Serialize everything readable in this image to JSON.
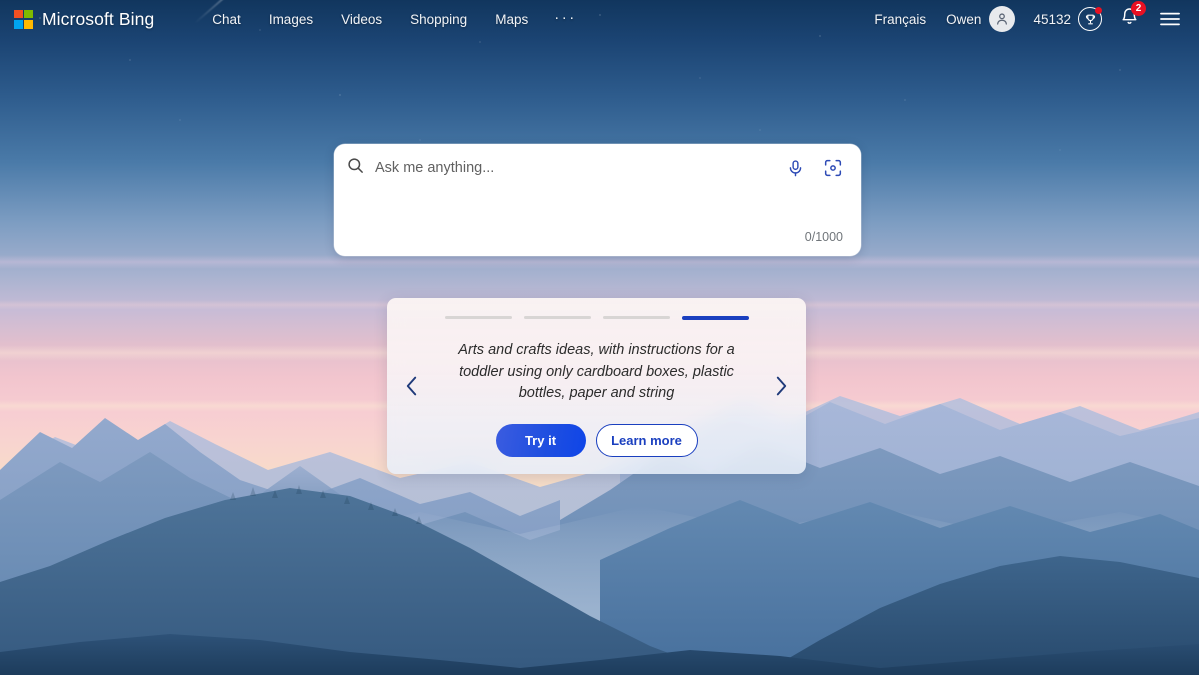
{
  "header": {
    "brand": "Microsoft Bing",
    "logo_colors": [
      "#f25022",
      "#7fba00",
      "#00a4ef",
      "#ffb900"
    ],
    "nav": [
      {
        "label": "Chat",
        "name": "nav-chat"
      },
      {
        "label": "Images",
        "name": "nav-images"
      },
      {
        "label": "Videos",
        "name": "nav-videos"
      },
      {
        "label": "Shopping",
        "name": "nav-shopping"
      },
      {
        "label": "Maps",
        "name": "nav-maps"
      },
      {
        "label": "···",
        "name": "nav-more"
      }
    ],
    "language": "Français",
    "account_name": "Owen",
    "rewards_points": "45132",
    "notification_count": "2",
    "icons": {
      "avatar": "person-icon",
      "rewards": "trophy-icon",
      "notifications": "bell-icon",
      "menu": "hamburger-menu-icon"
    }
  },
  "search": {
    "placeholder": "Ask me anything...",
    "value": "",
    "counter": "0/1000",
    "icons": {
      "search": "search-icon",
      "voice": "microphone-icon",
      "visual": "visual-search-icon"
    }
  },
  "carousel": {
    "slide_count": 4,
    "active_index": 3,
    "text": "Arts and crafts ideas, with instructions for a toddler using only cardboard boxes, plastic bottles, paper and string",
    "primary_button": "Try it",
    "secondary_button": "Learn more",
    "prev_label": "‹",
    "next_label": "›"
  },
  "theme": {
    "accent_blue": "#1a3fbf",
    "button_blue": "#1f4fe0",
    "badge_red": "#e81123",
    "card_bg": "#fdf6f4",
    "search_bg": "#ffffff",
    "sky_top": "#11365e",
    "sky_pink": "#f7cdd2",
    "mountain_far": "#b8c4e0",
    "mountain_near": "#2f567e"
  }
}
